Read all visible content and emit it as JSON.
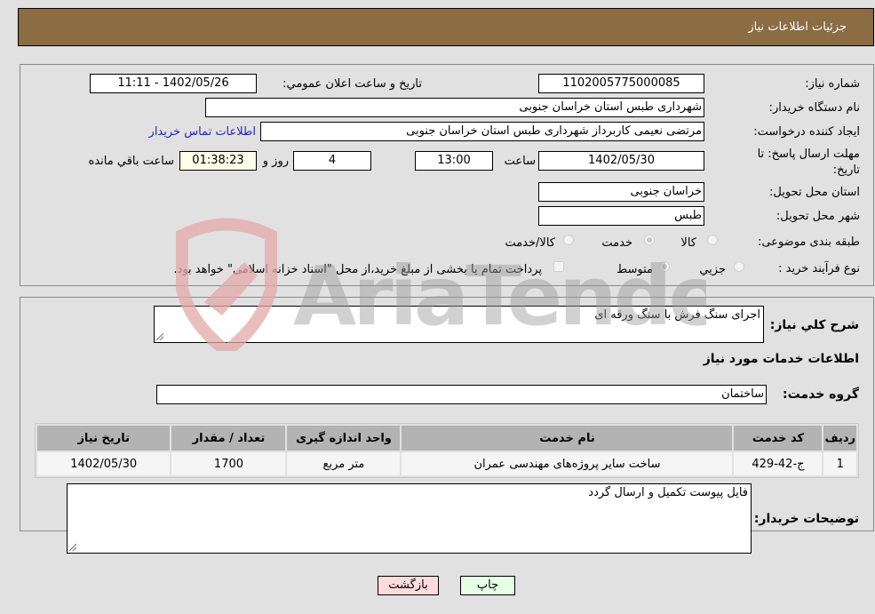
{
  "header": {
    "title": "جزئیات اطلاعات نیاز"
  },
  "details": {
    "need_number_label": "شماره نیاز:",
    "need_number": "1102005775000085",
    "announce_label": "تاریخ و ساعت اعلان عمومي:",
    "announce_value": "1402/05/26 - 11:11",
    "buyer_org_label": "نام دستگاه خریدار:",
    "buyer_org": "شهرداری طبس استان خراسان جنوبی",
    "creator_label": "ایجاد کننده درخواست:",
    "creator": "مرتضی نعیمی کاربرداز شهرداری طبس استان خراسان جنوبی",
    "contact_link": "اطلاعات تماس خریدار",
    "deadline_label_1": "مهلت ارسال پاسخ: تا",
    "deadline_label_2": "تاریخ:",
    "deadline_date": "1402/05/30",
    "time_label": "ساعت",
    "deadline_time": "13:00",
    "days_value": "4",
    "days_label": "روز و",
    "remaining_time": "01:38:23",
    "remaining_label": "ساعت باقي مانده",
    "province_label": "استان محل تحویل:",
    "province": "خراسان جنوبی",
    "city_label": "شهر محل تحویل:",
    "city": "طبس",
    "category_label": "طبقه بندی موضوعی:",
    "category_options": [
      {
        "label": "کالا",
        "checked": false
      },
      {
        "label": "خدمت",
        "checked": true
      },
      {
        "label": "کالا/خدمت",
        "checked": false
      }
    ],
    "process_label": "نوع فرآیند خرید :",
    "process_options": [
      {
        "label": "جزيي",
        "checked": false
      },
      {
        "label": "متوسط",
        "checked": true
      }
    ],
    "treasury_note": "پرداخت تمام یا بخشی از مبلغ خرید،از محل \"اسناد خزانه اسلامی\" خواهد بود.",
    "treasury_checked": false
  },
  "summary": {
    "description_label": "شرح کلي نياز:",
    "description": "اجرای سنگ فرش با سنگ ورقه ای",
    "services_heading": "اطلاعات خدمات مورد نیاز",
    "service_group_label": "گروه خدمت:",
    "service_group": "ساختمان"
  },
  "table": {
    "headers": [
      "ردیف",
      "کد خدمت",
      "نام خدمت",
      "واحد اندازه گیری",
      "تعداد / مقدار",
      "تاریخ نیاز"
    ],
    "rows": [
      [
        "1",
        "ج-42-429",
        "ساخت سایر پروژه‌های مهندسی عمران",
        "متر مربع",
        "1700",
        "1402/05/30"
      ]
    ]
  },
  "buyer_notes": {
    "label": "توضیحات خریدار:",
    "value": "فایل پیوست تکمیل و ارسال گردد"
  },
  "buttons": {
    "print": "چاپ",
    "back": "بازگشت"
  },
  "watermark": {
    "text": "AriaTender.neT"
  },
  "colors": {
    "header_bg": "#8b6c43",
    "back_button_bg": "#ffdcdc",
    "print_button_bg": "#e6ffe6",
    "link": "#2222cc"
  }
}
